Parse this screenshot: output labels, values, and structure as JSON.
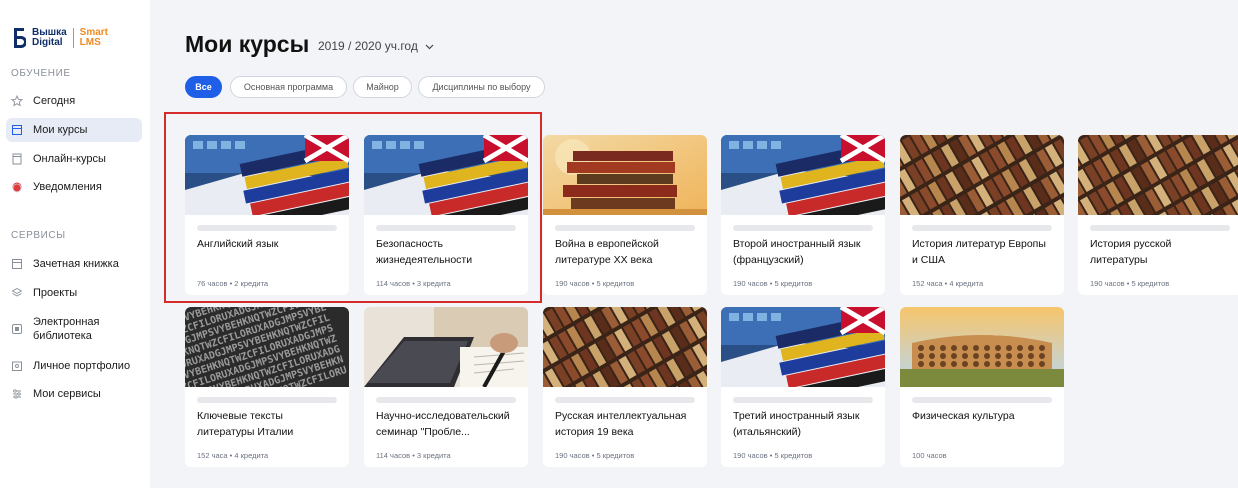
{
  "logo": {
    "line1": "Вышка",
    "line2": "Digital",
    "smart": "Smart",
    "lms": "LMS"
  },
  "sidebar": {
    "section1": "ОБУЧЕНИЕ",
    "items1": [
      {
        "label": "Сегодня",
        "icon": "star-icon"
      },
      {
        "label": "Мои курсы",
        "icon": "book-icon",
        "active": true
      },
      {
        "label": "Онлайн-курсы",
        "icon": "document-icon"
      },
      {
        "label": "Уведомления",
        "icon": "notification-dot-icon"
      }
    ],
    "section2": "СЕРВИСЫ",
    "items2": [
      {
        "label": "Зачетная книжка",
        "icon": "book-icon"
      },
      {
        "label": "Проекты",
        "icon": "layers-icon"
      },
      {
        "label": "Электронная библиотека",
        "line1": "Электронная",
        "line2": "библиотека",
        "icon": "library-icon"
      },
      {
        "label": "Личное портфолио",
        "icon": "portfolio-icon"
      },
      {
        "label": "Мои сервисы",
        "icon": "services-icon"
      }
    ]
  },
  "header": {
    "title": "Мои курсы",
    "year": "2019 / 2020 уч.год"
  },
  "filters": [
    "Все",
    "Основная программа",
    "Майнор",
    "Дисциплины по выбору"
  ],
  "courses": [
    {
      "line1": "Английский язык",
      "line2": "",
      "meta": "76 часов • 2 кредита",
      "image": "language-books"
    },
    {
      "line1": "Безопасность",
      "line2": "жизнедеятельности",
      "meta": "114 часов • 3 кредита",
      "image": "language-books"
    },
    {
      "line1": "Война в европейской",
      "line2": "литературе XX века",
      "meta": "190 часов • 5 кредитов",
      "image": "book-stack"
    },
    {
      "line1": "Второй иностранный язык",
      "line2": "(французский)",
      "meta": "190 часов • 5 кредитов",
      "image": "language-books"
    },
    {
      "line1": "История литератур Европы",
      "line2": "и США",
      "meta": "152 часа • 4 кредита",
      "image": "library-shelf"
    },
    {
      "line1": "История русской",
      "line2": "литературы",
      "meta": "190 часов • 5 кредитов",
      "image": "library-shelf"
    },
    {
      "line1": "Ключевые тексты",
      "line2": "литературы Италии",
      "meta": "152 часа • 4 кредита",
      "image": "typewriter-letters"
    },
    {
      "line1": "Научно-исследовательский",
      "line2": "семинар \"Пробле...",
      "meta": "114 часов • 3 кредита",
      "image": "laptop-writing"
    },
    {
      "line1": "Русская интеллектуальная",
      "line2": "история 19 века",
      "meta": "190 часов • 5 кредитов",
      "image": "library-shelf"
    },
    {
      "line1": "Третий иностранный язык",
      "line2": "(итальянский)",
      "meta": "190 часов • 5 кредитов",
      "image": "language-books"
    },
    {
      "line1": "Физическая культура",
      "line2": "",
      "meta": "100 часов",
      "image": "colosseum"
    }
  ],
  "colors": {
    "accent": "#1f5fe8",
    "highlight": "#d62b2b",
    "logo": "#0f2d69",
    "lms": "#f08a24"
  }
}
